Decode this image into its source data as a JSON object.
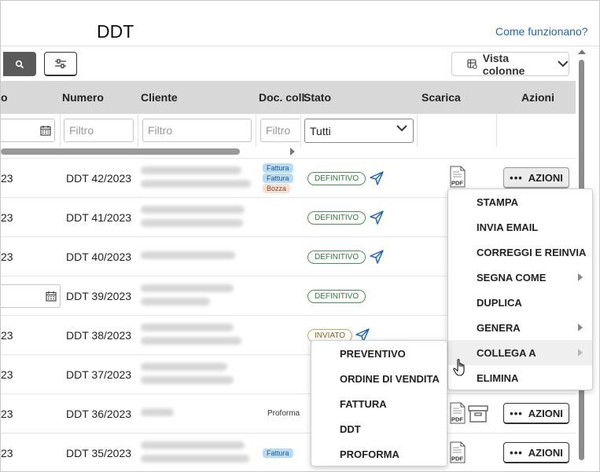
{
  "page": {
    "title": "DDT",
    "help_link": "Come funzionano?"
  },
  "toolbar": {
    "columns_view": "Vista colonne"
  },
  "table": {
    "headers": {
      "date": "o",
      "numero": "Numero",
      "cliente": "Cliente",
      "doc_coll": "Doc. coll",
      "stato": "Stato",
      "scarica": "Scarica",
      "azioni": "Azioni"
    },
    "filters": {
      "numero": "Filtro",
      "cliente": "Filtro",
      "doc_coll": "Filtro",
      "stato": "Tutti"
    },
    "rows": [
      {
        "date": "23",
        "numero": "DDT 42/2023",
        "tags": [
          "Fattura",
          "Fattura",
          "Bozza"
        ],
        "status": "DEFINITIVO"
      },
      {
        "date": "23",
        "numero": "DDT 41/2023",
        "status": "DEFINITIVO"
      },
      {
        "date": "23",
        "numero": "DDT 40/2023",
        "status": "DEFINITIVO"
      },
      {
        "date": "",
        "numero": "DDT 39/2023",
        "status": "DEFINITIVO"
      },
      {
        "date": "23",
        "numero": "DDT 38/2023",
        "status": "INVIATO"
      },
      {
        "date": "23",
        "numero": "DDT 37/2023"
      },
      {
        "date": "23",
        "numero": "DDT 36/2023",
        "doc_plain": "Proforma"
      },
      {
        "date": "23",
        "numero": "DDT 35/2023",
        "tags": [
          "Fattura"
        ]
      }
    ],
    "actions_label": "AZIONI",
    "pdf_label": "PDF"
  },
  "context_menu": {
    "items": [
      "STAMPA",
      "INVIA EMAIL",
      "CORREGGI E REINVIA",
      "SEGNA COME",
      "DUPLICA",
      "GENERA",
      "COLLEGA A",
      "ELIMINA"
    ]
  },
  "submenu": {
    "items": [
      "PREVENTIVO",
      "ORDINE DI VENDITA",
      "FATTURA",
      "DDT",
      "PROFORMA"
    ]
  },
  "colors": {
    "accent_link": "#1a66c8",
    "status_definitivo": "#3c9a4a",
    "status_inviato": "#d6a24a",
    "tag_fattura": "#b8dcf5",
    "tag_bozza": "#f7dfd2"
  }
}
